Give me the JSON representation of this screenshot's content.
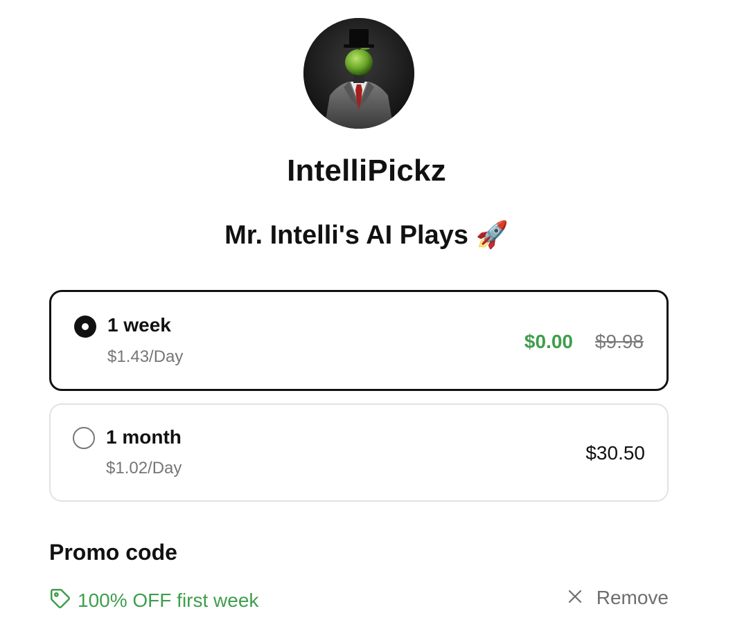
{
  "merchant": {
    "name": "IntelliPickz",
    "avatar_icon": "apple-face-businessman-avatar"
  },
  "product": {
    "title": "Mr. Intelli's AI Plays 🚀"
  },
  "plans": [
    {
      "label": "1 week",
      "per_day": "$1.43/Day",
      "price": "$0.00",
      "original_price": "$9.98",
      "selected": true
    },
    {
      "label": "1 month",
      "per_day": "$1.02/Day",
      "price": "$30.50",
      "selected": false
    }
  ],
  "promo": {
    "heading": "Promo code",
    "applied_text": "100% OFF first week",
    "icon": "tag-icon",
    "remove_label": "Remove",
    "remove_icon": "close-icon"
  },
  "colors": {
    "accent_green": "#3f9e4c",
    "text_primary": "#111111",
    "text_secondary": "#767676",
    "border_selected": "#111111",
    "border_default": "#e2e2e2"
  }
}
